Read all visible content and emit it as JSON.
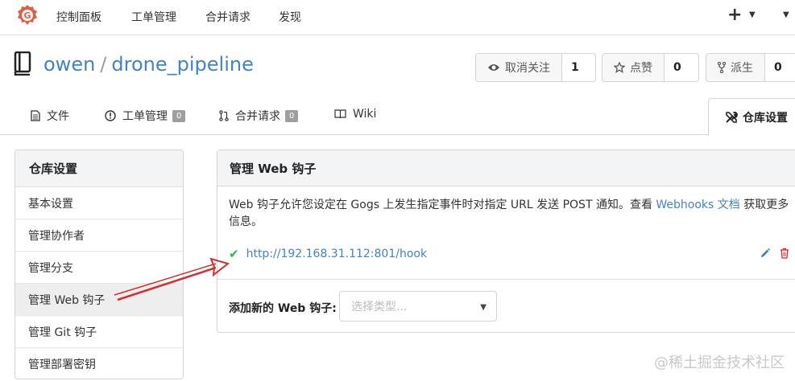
{
  "nav": {
    "items": [
      "控制面板",
      "工单管理",
      "合并请求",
      "发现"
    ],
    "plus": "+"
  },
  "repo": {
    "owner": "owen",
    "separator": "/",
    "name": "drone_pipeline",
    "unwatch_label": "取消关注",
    "unwatch_count": "1",
    "star_label": "点赞",
    "star_count": "0",
    "fork_label": "派生",
    "fork_count": "0"
  },
  "tabs": {
    "files": "文件",
    "issues": "工单管理",
    "issues_count": "0",
    "pulls": "合并请求",
    "pulls_count": "0",
    "wiki": "Wiki",
    "settings": "仓库设置"
  },
  "sidebar": {
    "header": "仓库设置",
    "items": [
      "基本设置",
      "管理协作者",
      "管理分支",
      "管理 Web 钩子",
      "管理 Git 钩子",
      "管理部署密钥"
    ]
  },
  "webhooks": {
    "title": "管理 Web 钩子",
    "desc_before": "Web 钩子允许您设定在 Gogs 上发生指定事件时对指定 URL 发送 POST 通知。查看 ",
    "desc_link": "Webhooks 文档",
    "desc_after": " 获取更多信息。",
    "hook_url": "http://192.168.31.112:801/hook",
    "add_label": "添加新的 Web 钩子:",
    "select_placeholder": "选择类型..."
  },
  "watermark": "@稀土掘金技术社区",
  "colors": {
    "link": "#4183c4",
    "success": "#21ba45",
    "danger": "#db2828",
    "logo": "#e05d44",
    "arrow": "#d32f2f"
  }
}
